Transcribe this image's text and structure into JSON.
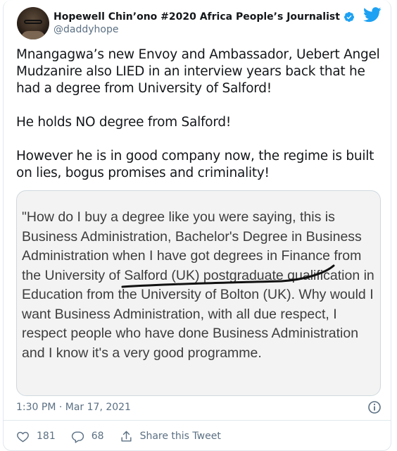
{
  "author": {
    "display_name": "Hopewell Chin’ono #2020 Africa People’s Journalist",
    "handle": "@daddyhope"
  },
  "tweet": {
    "paragraphs": [
      "Mnangagwa’s new Envoy and Ambassador, Uebert Angel Mudzanire also LIED in an interview years back that he had a degree from University of Salford!",
      "He holds NO degree from Salford!",
      "However he is in good company now, the regime is built on lies, bogus promises and criminality!"
    ],
    "image_quote": "\"How do I buy a degree like you were saying, this is Business Administration, Bachelor's Degree in Business Administration when I have got degrees in Finance from the University of Salford (UK) postgraduate qualification in Education from the University of Bolton (UK). Why would I want Business Administration, with all due respect, I respect people who have done Business Administration and I know it's a very good programme.",
    "timestamp": "1:30 PM · Mar 17, 2021"
  },
  "actions": {
    "likes": "181",
    "replies": "68",
    "share_label": "Share this Tweet"
  },
  "colors": {
    "twitter_blue": "#1da1f2",
    "secondary_text": "#5b7083",
    "primary_text": "#14171a"
  },
  "icons": [
    "verified-badge-icon",
    "twitter-bird-icon",
    "info-icon",
    "heart-icon",
    "reply-icon",
    "share-icon"
  ]
}
